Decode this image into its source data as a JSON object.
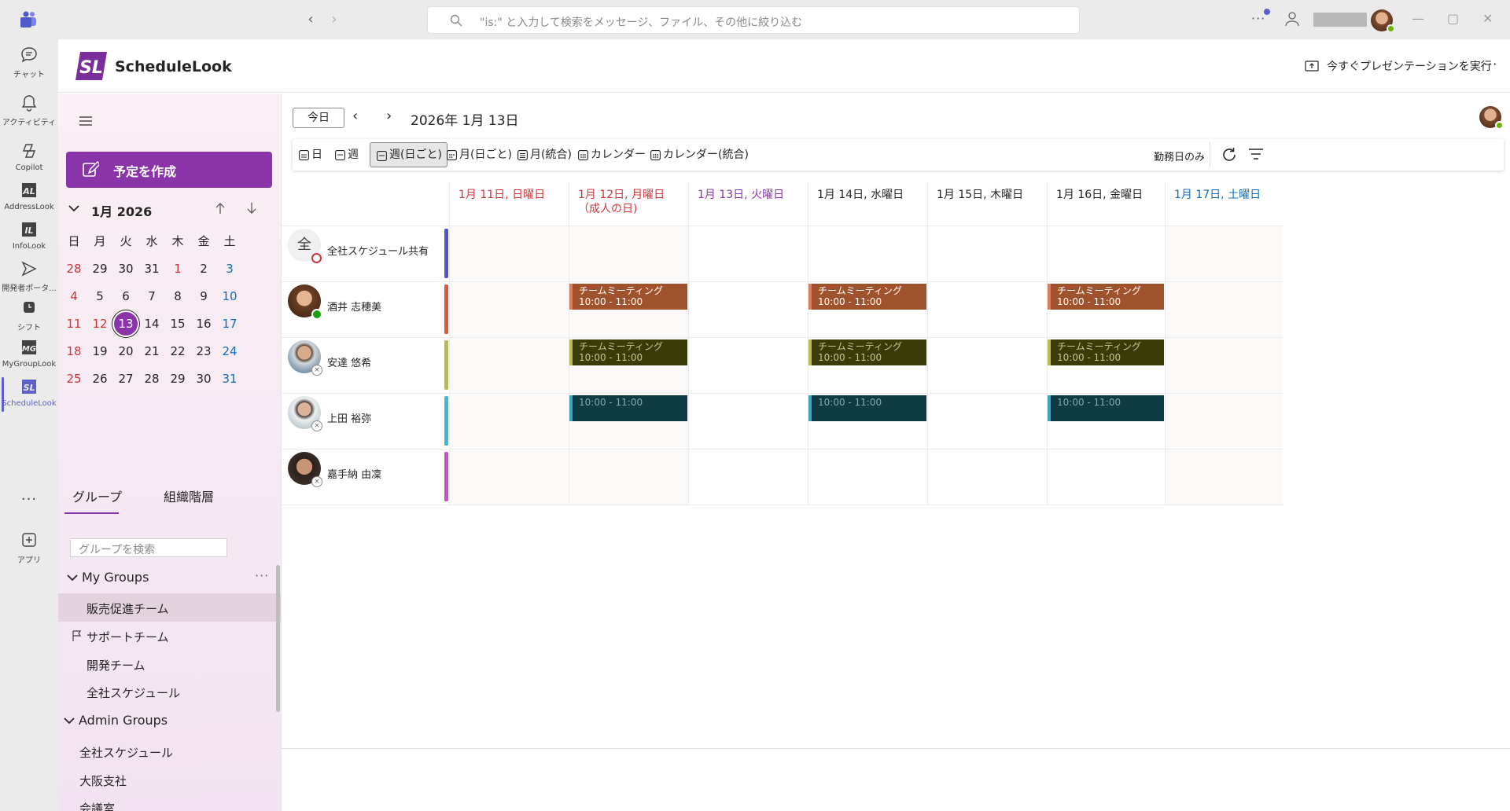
{
  "titlebar": {
    "search_placeholder": "\"is:\" と入力して検索をメッセージ、ファイル、その他に絞り込む",
    "more": "···",
    "minimize": "—",
    "maximize": "▢",
    "close": "✕"
  },
  "rail": {
    "items": [
      {
        "label": "チャット",
        "icon": "chat-icon"
      },
      {
        "label": "アクティビティ",
        "icon": "bell-icon"
      },
      {
        "label": "Copilot",
        "icon": "copilot-icon"
      },
      {
        "label": "AddressLook",
        "icon": "addresslook-icon"
      },
      {
        "label": "InfoLook",
        "icon": "infolook-icon"
      },
      {
        "label": "開発者ポータ...",
        "icon": "developer-portal-icon"
      },
      {
        "label": "シフト",
        "icon": "shifts-icon"
      },
      {
        "label": "MyGroupLook",
        "icon": "mygrouplook-icon"
      },
      {
        "label": "ScheduleLook",
        "icon": "schedulelook-icon"
      },
      {
        "label": "アプリ",
        "icon": "apps-icon"
      }
    ],
    "more": "···"
  },
  "app": {
    "name": "ScheduleLook",
    "present_label": "今すぐプレゼンテーションを実行",
    "more": "···"
  },
  "sidebar": {
    "create_label": "予定を作成",
    "calendar_title": "1月 2026",
    "weekdays": [
      "日",
      "月",
      "火",
      "水",
      "木",
      "金",
      "土"
    ],
    "weeks": [
      [
        "28",
        "29",
        "30",
        "31",
        "1",
        "2",
        "3"
      ],
      [
        "4",
        "5",
        "6",
        "7",
        "8",
        "9",
        "10"
      ],
      [
        "11",
        "12",
        "13",
        "14",
        "15",
        "16",
        "17"
      ],
      [
        "18",
        "19",
        "20",
        "21",
        "22",
        "23",
        "24"
      ],
      [
        "25",
        "26",
        "27",
        "28",
        "29",
        "30",
        "31"
      ]
    ],
    "tabs": [
      "グループ",
      "組織階層"
    ],
    "group_search_placeholder": "グループを検索",
    "my_groups_label": "My Groups",
    "my_groups_more": "···",
    "my_groups": [
      "販売促進チーム",
      "サポートチーム",
      "開発チーム",
      "全社スケジュール"
    ],
    "admin_groups_label": "Admin Groups",
    "admin_groups": [
      "全社スケジュール",
      "大阪支社",
      "会議室"
    ]
  },
  "main": {
    "today_label": "今日",
    "prev": "‹",
    "next": "›",
    "date_title": "2026年 1月 13日",
    "views": [
      "日",
      "週",
      "週(日ごと)",
      "月(日ごと)",
      "月(統合)",
      "カレンダー",
      "カレンダー(統合)"
    ],
    "active_view": "週(日ごと)",
    "workday_label": "勤務日のみ",
    "days": [
      {
        "label": "1月 11日, 日曜日",
        "color": "#d13438"
      },
      {
        "label": "1月 12日, 月曜日 （成人の日)",
        "color": "#d13438"
      },
      {
        "label": "1月 13日, 火曜日",
        "color": "#8a34a9"
      },
      {
        "label": "1月 14日, 水曜日",
        "color": "#242424"
      },
      {
        "label": "1月 15日, 木曜日",
        "color": "#242424"
      },
      {
        "label": "1月 16日, 金曜日",
        "color": "#242424"
      },
      {
        "label": "1月 17日, 土曜日",
        "color": "#0f6cbd"
      }
    ],
    "people": [
      {
        "name": "全社スケジュール共有",
        "avatar_text": "全",
        "bar_color": "#4f52d4"
      },
      {
        "name": "酒井 志穂美",
        "bar_color": "#d9573c"
      },
      {
        "name": "安達 悠希",
        "bar_color": "#b8ba4a"
      },
      {
        "name": "上田 裕弥",
        "bar_color": "#3fb8d6"
      },
      {
        "name": "嘉手納 由凜",
        "bar_color": "#c94fc7"
      }
    ],
    "status_offline": "×",
    "events": {
      "meeting_title": "チームミーティング",
      "time": "10:00 - 11:00"
    }
  }
}
